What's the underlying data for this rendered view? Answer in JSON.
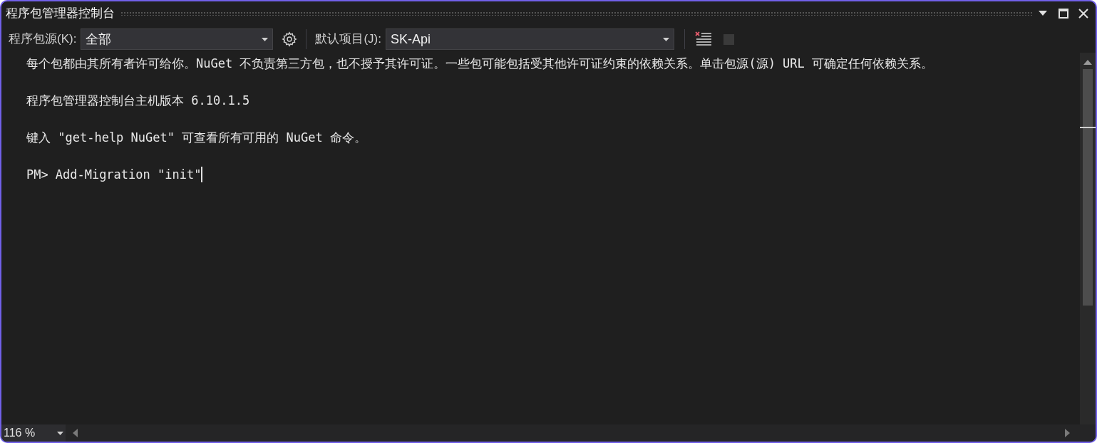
{
  "window": {
    "title": "程序包管理器控制台"
  },
  "toolbar": {
    "source_label": "程序包源(K):",
    "source_value": "全部",
    "project_label": "默认项目(J):",
    "project_value": "SK-Api",
    "stop_button": {
      "disabled": true
    }
  },
  "console": {
    "lines": [
      {
        "kind": "text",
        "text": "每个包都由其所有者许可给你。NuGet 不负责第三方包，也不授予其许可证。一些包可能包括受其他许可证约束的依赖关系。单击包源(源) URL 可确定任何依赖关系。"
      },
      {
        "kind": "blank"
      },
      {
        "kind": "text",
        "text": "程序包管理器控制台主机版本 6.10.1.5"
      },
      {
        "kind": "blank"
      },
      {
        "kind": "text",
        "text": "键入 \"get-help NuGet\" 可查看所有可用的 NuGet 命令。"
      },
      {
        "kind": "blank"
      },
      {
        "kind": "prompt",
        "prompt": "PM>",
        "text": "Add-Migration \"init\""
      }
    ]
  },
  "status_bar": {
    "zoom": "116 %"
  }
}
